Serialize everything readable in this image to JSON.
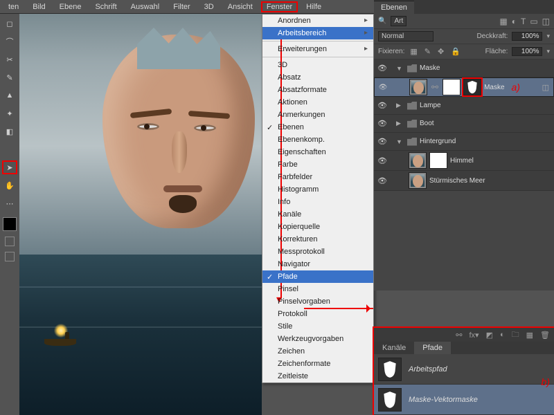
{
  "menu": {
    "items": [
      "ten",
      "Bild",
      "Ebene",
      "Schrift",
      "Auswahl",
      "Filter",
      "3D",
      "Ansicht",
      "Fenster",
      "Hilfe"
    ],
    "open_index": 8
  },
  "dropdown": {
    "groups": [
      [
        {
          "label": "Anordnen",
          "arrow": true
        },
        {
          "label": "Arbeitsbereich",
          "arrow": true,
          "hi": true
        }
      ],
      [
        {
          "label": "Erweiterungen",
          "arrow": true
        }
      ],
      [
        {
          "label": "3D"
        },
        {
          "label": "Absatz"
        },
        {
          "label": "Absatzformate"
        },
        {
          "label": "Aktionen"
        },
        {
          "label": "Anmerkungen"
        },
        {
          "label": "Ebenen",
          "checked": true
        },
        {
          "label": "Ebenenkomp."
        },
        {
          "label": "Eigenschaften"
        },
        {
          "label": "Farbe"
        },
        {
          "label": "Farbfelder"
        },
        {
          "label": "Histogramm"
        },
        {
          "label": "Info"
        },
        {
          "label": "Kanäle"
        },
        {
          "label": "Kopierquelle"
        },
        {
          "label": "Korrekturen"
        },
        {
          "label": "Messprotokoll"
        },
        {
          "label": "Navigator"
        },
        {
          "label": "Pfade",
          "checked": true,
          "hi": true
        },
        {
          "label": "Pinsel"
        },
        {
          "label": "Pinselvorgaben"
        },
        {
          "label": "Protokoll"
        },
        {
          "label": "Stile"
        },
        {
          "label": "Werkzeugvorgaben"
        },
        {
          "label": "Zeichen"
        },
        {
          "label": "Zeichenformate"
        },
        {
          "label": "Zeitleiste"
        }
      ]
    ]
  },
  "layers_panel": {
    "tab": "Ebenen",
    "filter_kind": "Art",
    "blend_mode": "Normal",
    "opacity_label": "Deckkraft:",
    "opacity_value": "100%",
    "lock_label": "Fixieren:",
    "fill_label": "Fläche:",
    "fill_value": "100%",
    "layers": [
      {
        "type": "group",
        "name": "Maske",
        "open": true,
        "depth": 0
      },
      {
        "type": "layer",
        "name": "Maske",
        "selected": true,
        "vmask": true,
        "depth": 1,
        "ann": "a)"
      },
      {
        "type": "group",
        "name": "Lampe",
        "open": false,
        "depth": 0
      },
      {
        "type": "group",
        "name": "Boot",
        "open": false,
        "depth": 0
      },
      {
        "type": "group",
        "name": "Hintergrund",
        "open": true,
        "depth": 0
      },
      {
        "type": "layer",
        "name": "Himmel",
        "mask": true,
        "depth": 1
      },
      {
        "type": "layer",
        "name": "Stürmisches Meer",
        "depth": 1
      }
    ]
  },
  "paths_panel": {
    "tabs": [
      "Kanäle",
      "Pfade"
    ],
    "active_tab": 1,
    "rows": [
      {
        "name": "Arbeitspfad"
      },
      {
        "name": "Maske-Vektormaske",
        "selected": true
      }
    ],
    "ann": "b)"
  },
  "tooltips": {
    "tools": [
      "move",
      "marquee",
      "lasso",
      "crop",
      "eyedropper",
      "brush",
      "stamp",
      "eraser",
      "blank",
      "path-select",
      "hand"
    ]
  }
}
